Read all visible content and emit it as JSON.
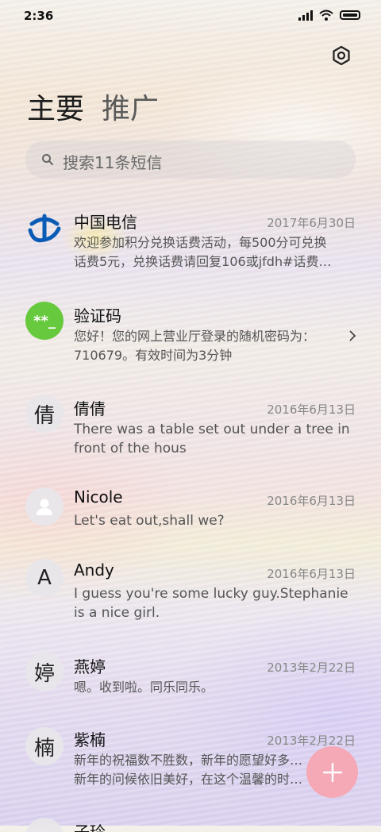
{
  "status_bar": {
    "time": "2:36"
  },
  "tabs": [
    {
      "label": "主要",
      "active": true
    },
    {
      "label": "推广",
      "active": false
    }
  ],
  "search": {
    "placeholder": "搜索11条短信"
  },
  "conversations": [
    {
      "name": "中国电信",
      "date": "2017年6月30日",
      "line1": "欢迎参加积分兑换话费活动，每500分可兑换",
      "line2": "话费5元，兑换话费请回复106或jfdh#话费…",
      "avatar": "telecom-logo"
    },
    {
      "name": "验证码",
      "date": "",
      "line1": "您好！您的网上营业厅登录的随机密码为：",
      "line2": "710679。有效时间为3分钟",
      "avatar_text": "**_",
      "avatar_color": "#67c93e"
    },
    {
      "name": "倩倩",
      "date": "2016年6月13日",
      "line1": "There was a table set out under a tree in",
      "line2": "front of the hous",
      "avatar_text": "倩"
    },
    {
      "name": "Nicole",
      "date": "2016年6月13日",
      "line1": "Let's eat out,shall we?",
      "line2": "",
      "avatar": "person-icon"
    },
    {
      "name": "Andy",
      "date": "2016年6月13日",
      "line1": "I guess you're some lucky guy.Stephanie",
      "line2": "is a nice girl.",
      "avatar_text": "A"
    },
    {
      "name": "燕婷",
      "date": "2013年2月22日",
      "line1": "嗯。收到啦。同乐同乐。",
      "line2": "",
      "avatar_text": "婷"
    },
    {
      "name": "紫楠",
      "date": "2013年2月22日",
      "line1": "新年的祝福数不胜数，新年的愿望好多好多，",
      "line2": "新年的问候依旧美好，在这个温馨的时刻…",
      "avatar_text": "楠"
    },
    {
      "name": "子玲",
      "date": "",
      "line1": "",
      "line2": "",
      "avatar_text": ""
    }
  ],
  "colors": {
    "fab": "#f7a6b2",
    "verify_avatar": "#67c93e",
    "telecom_blue": "#0a5bb5"
  }
}
